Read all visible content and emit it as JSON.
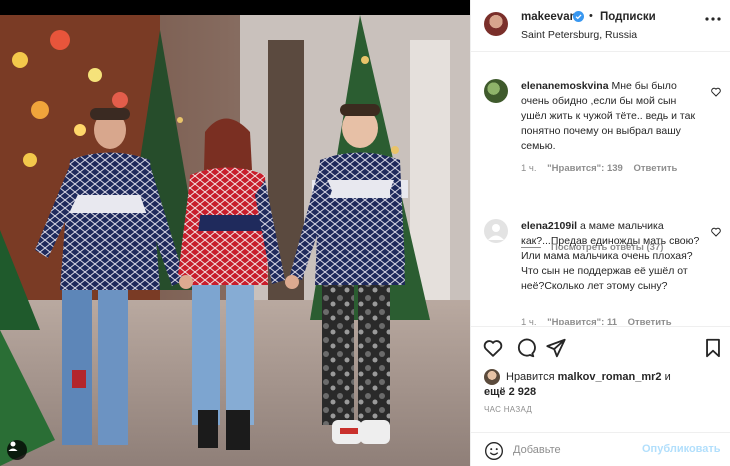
{
  "post": {
    "author": {
      "username": "makeevan",
      "verified": true,
      "follow_label": "Подписки",
      "location": "Saint Petersburg, Russia"
    },
    "comments": [
      {
        "username": "elenanemoskvina",
        "text": "Мне бы было очень обидно ,если бы мой сын ушёл жить к чужой тёте.. ведь и так понятно почему он выбрал вашу семью.",
        "time": "1 ч.",
        "likes": "\"Нравится\": 139",
        "reply_label": "Ответить"
      },
      {
        "username": "elena2109il",
        "text": "а маме мальчика как?...Предав единожды мать свою?Или мама мальчика очень плохая?Что сын не поддержав её ушёл от неё?Сколько лет этому сыну?",
        "time": "1 ч.",
        "likes": "\"Нравится\": 11",
        "reply_label": "Ответить"
      }
    ],
    "view_replies": "Посмотреть ответы (37)",
    "likes": {
      "prefix": "Нравится",
      "user": "malkov_roman_mr2",
      "suffix": "и",
      "others": "ещё 2 928"
    },
    "time_ago": "ЧАС НАЗАД",
    "add_comment": {
      "placeholder": "Добавьте",
      "publish_label": "Опубликовать"
    },
    "icons": {
      "like": "heart-icon",
      "comment": "comment-icon",
      "share": "send-icon",
      "save": "bookmark-icon",
      "more": "more-icon",
      "emoji": "emoji-icon",
      "tagged_user": "user-icon"
    },
    "colors": {
      "verified": "#3897f0",
      "publish_disabled": "#b2dffc",
      "secondary_text": "#8e8e8e"
    }
  }
}
